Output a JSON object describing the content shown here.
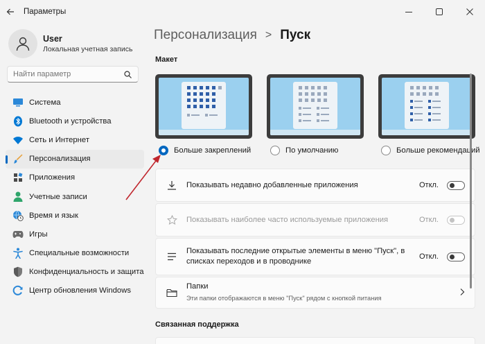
{
  "window": {
    "title": "Параметры"
  },
  "user": {
    "name": "User",
    "account_type": "Локальная учетная запись"
  },
  "search": {
    "placeholder": "Найти параметр"
  },
  "sidebar": {
    "items": [
      {
        "label": "Система",
        "icon": "system-icon"
      },
      {
        "label": "Bluetooth и устройства",
        "icon": "bluetooth-icon"
      },
      {
        "label": "Сеть и Интернет",
        "icon": "wifi-icon"
      },
      {
        "label": "Персонализация",
        "icon": "brush-icon",
        "active": true
      },
      {
        "label": "Приложения",
        "icon": "apps-icon"
      },
      {
        "label": "Учетные записи",
        "icon": "account-icon"
      },
      {
        "label": "Время и язык",
        "icon": "globe-clock-icon"
      },
      {
        "label": "Игры",
        "icon": "gamepad-icon"
      },
      {
        "label": "Специальные возможности",
        "icon": "accessibility-icon"
      },
      {
        "label": "Конфиденциальность и защита",
        "icon": "shield-icon"
      },
      {
        "label": "Центр обновления Windows",
        "icon": "update-icon"
      }
    ]
  },
  "breadcrumb": {
    "parent": "Персонализация",
    "separator": ">",
    "current": "Пуск"
  },
  "layout": {
    "section_label": "Макет",
    "options": [
      {
        "label": "Больше закреплений",
        "selected": true
      },
      {
        "label": "По умолчанию",
        "selected": false
      },
      {
        "label": "Больше рекомендаций",
        "selected": false
      }
    ]
  },
  "settings": [
    {
      "label": "Показывать недавно добавленные приложения",
      "state": "Откл.",
      "icon": "download-icon",
      "disabled": false
    },
    {
      "label": "Показывать наиболее часто используемые приложения",
      "state": "Откл.",
      "icon": "star-icon",
      "disabled": true
    },
    {
      "label": "Показывать последние открытые элементы в меню \"Пуск\", в списках переходов и в проводнике",
      "state": "Откл.",
      "icon": "list-icon",
      "disabled": false
    }
  ],
  "folders": {
    "label": "Папки",
    "description": "Эти папки отображаются в меню \"Пуск\" рядом с кнопкой питания",
    "icon": "folder-icon"
  },
  "related": {
    "label": "Связанная поддержка"
  },
  "colors": {
    "accent": "#0067c0",
    "arrow": "#c0262d"
  }
}
